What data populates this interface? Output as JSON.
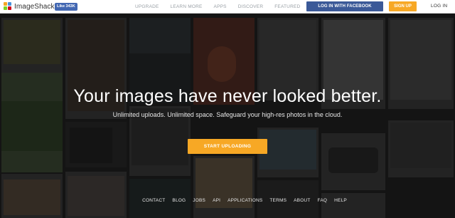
{
  "header": {
    "logo_text": "ImageShack",
    "fb_like": "Like 343K",
    "nav": [
      "UPGRADE",
      "LEARN MORE",
      "APPS",
      "DISCOVER",
      "FEATURED"
    ],
    "login_facebook": "LOG IN WITH FACEBOOK",
    "sign_up": "SIGN UP",
    "log_in": "LOG IN"
  },
  "hero": {
    "title": "Your images have never looked better.",
    "subtitle": "Unlimited uploads. Unlimited space. Safeguard your high-res photos in the cloud.",
    "cta": "START UPLOADING"
  },
  "footer": {
    "links": [
      "CONTACT",
      "BLOG",
      "JOBS",
      "API",
      "APPLICATIONS",
      "TERMS",
      "ABOUT",
      "FAQ",
      "HELP"
    ]
  },
  "colors": {
    "accent_orange": "#f7a825",
    "facebook_blue": "#3b5998",
    "header_bg": "#ffffff"
  }
}
